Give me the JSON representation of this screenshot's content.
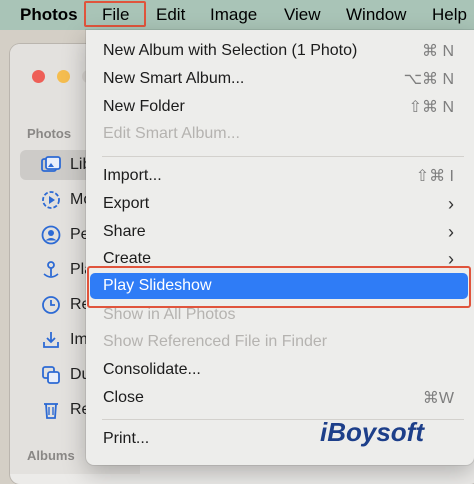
{
  "menubar": {
    "app_name": "Photos",
    "items": [
      "File",
      "Edit",
      "Image",
      "View",
      "Window",
      "Help"
    ]
  },
  "sidebar": {
    "section_photos": "Photos",
    "section_albums": "Albums",
    "rows": [
      {
        "label": "Lib",
        "icon": "library-icon",
        "selected": true
      },
      {
        "label": "Mo",
        "icon": "memories-icon"
      },
      {
        "label": "Pe",
        "icon": "people-icon"
      },
      {
        "label": "Pla",
        "icon": "places-icon"
      },
      {
        "label": "Re",
        "icon": "recents-icon"
      },
      {
        "label": "Im",
        "icon": "imports-icon"
      },
      {
        "label": "Du",
        "icon": "duplicates-icon"
      },
      {
        "label": "Re",
        "icon": "recently-deleted-icon"
      }
    ]
  },
  "file_menu": {
    "items": [
      {
        "label": "New Album with Selection (1 Photo)",
        "shortcut": "⌘ N"
      },
      {
        "label": "New Smart Album...",
        "shortcut": "⌥⌘ N"
      },
      {
        "label": "New Folder",
        "shortcut": "⇧⌘ N"
      },
      {
        "label": "Edit Smart Album...",
        "disabled": true
      },
      {
        "label": "Import...",
        "shortcut": "⇧⌘ I"
      },
      {
        "label": "Export",
        "submenu": true
      },
      {
        "label": "Share",
        "submenu": true
      },
      {
        "label": "Create",
        "submenu": true
      },
      {
        "label": "Play Slideshow",
        "highlighted": true
      },
      {
        "label": "Show in All Photos",
        "disabled": true
      },
      {
        "label": "Show Referenced File in Finder",
        "disabled": true
      },
      {
        "label": "Consolidate..."
      },
      {
        "label": "Close",
        "shortcut": "⌘W"
      },
      {
        "label": "Print..."
      }
    ]
  },
  "watermark": {
    "text": "iBoysoft"
  },
  "colors": {
    "menubar_bg": "#a9c4b7",
    "highlight": "#2f7cf6",
    "annotation_box": "#e0543c"
  }
}
